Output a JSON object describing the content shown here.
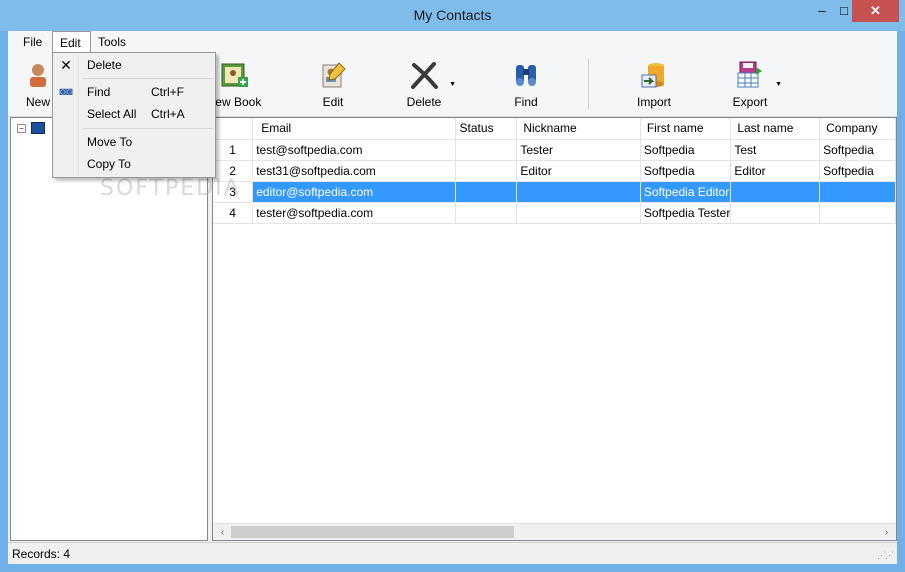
{
  "window": {
    "title": "My Contacts",
    "controls": {
      "minimize": "–",
      "maximize": "□",
      "close": "✕"
    }
  },
  "menubar": {
    "file": "File",
    "edit": "Edit",
    "tools": "Tools"
  },
  "edit_menu": {
    "delete": "Delete",
    "find": "Find",
    "find_shortcut": "Ctrl+F",
    "select_all": "Select All",
    "select_all_shortcut": "Ctrl+A",
    "move_to": "Move To",
    "copy_to": "Copy To"
  },
  "toolbar": {
    "new": "New",
    "new_book": "New Book",
    "edit": "Edit",
    "delete": "Delete",
    "find": "Find",
    "import": "Import",
    "export": "Export"
  },
  "watermark": "SOFTPEDIA",
  "table": {
    "columns": [
      "Email",
      "Status",
      "Nickname",
      "First name",
      "Last name",
      "Company"
    ],
    "rows": [
      {
        "num": "1",
        "email": "test@softpedia.com",
        "status": "",
        "nickname": "Tester",
        "first": "Softpedia",
        "last": "Test",
        "company": "Softpedia"
      },
      {
        "num": "2",
        "email": "test31@softpedia.com",
        "status": "",
        "nickname": "Editor",
        "first": "Softpedia",
        "last": "Editor",
        "company": "Softpedia"
      },
      {
        "num": "3",
        "email": "editor@softpedia.com",
        "status": "",
        "nickname": "",
        "first": "Softpedia Editor",
        "last": "",
        "company": ""
      },
      {
        "num": "4",
        "email": "tester@softpedia.com",
        "status": "",
        "nickname": "",
        "first": "Softpedia Tester",
        "last": "",
        "company": ""
      }
    ],
    "selected_row": 3
  },
  "scrollbar": {
    "left": "‹",
    "right": "›"
  },
  "status": {
    "records": "Records: 4"
  },
  "colors": {
    "title_bar": "#7fbcec",
    "selection": "#3399ff",
    "close_button": "#c75050"
  }
}
